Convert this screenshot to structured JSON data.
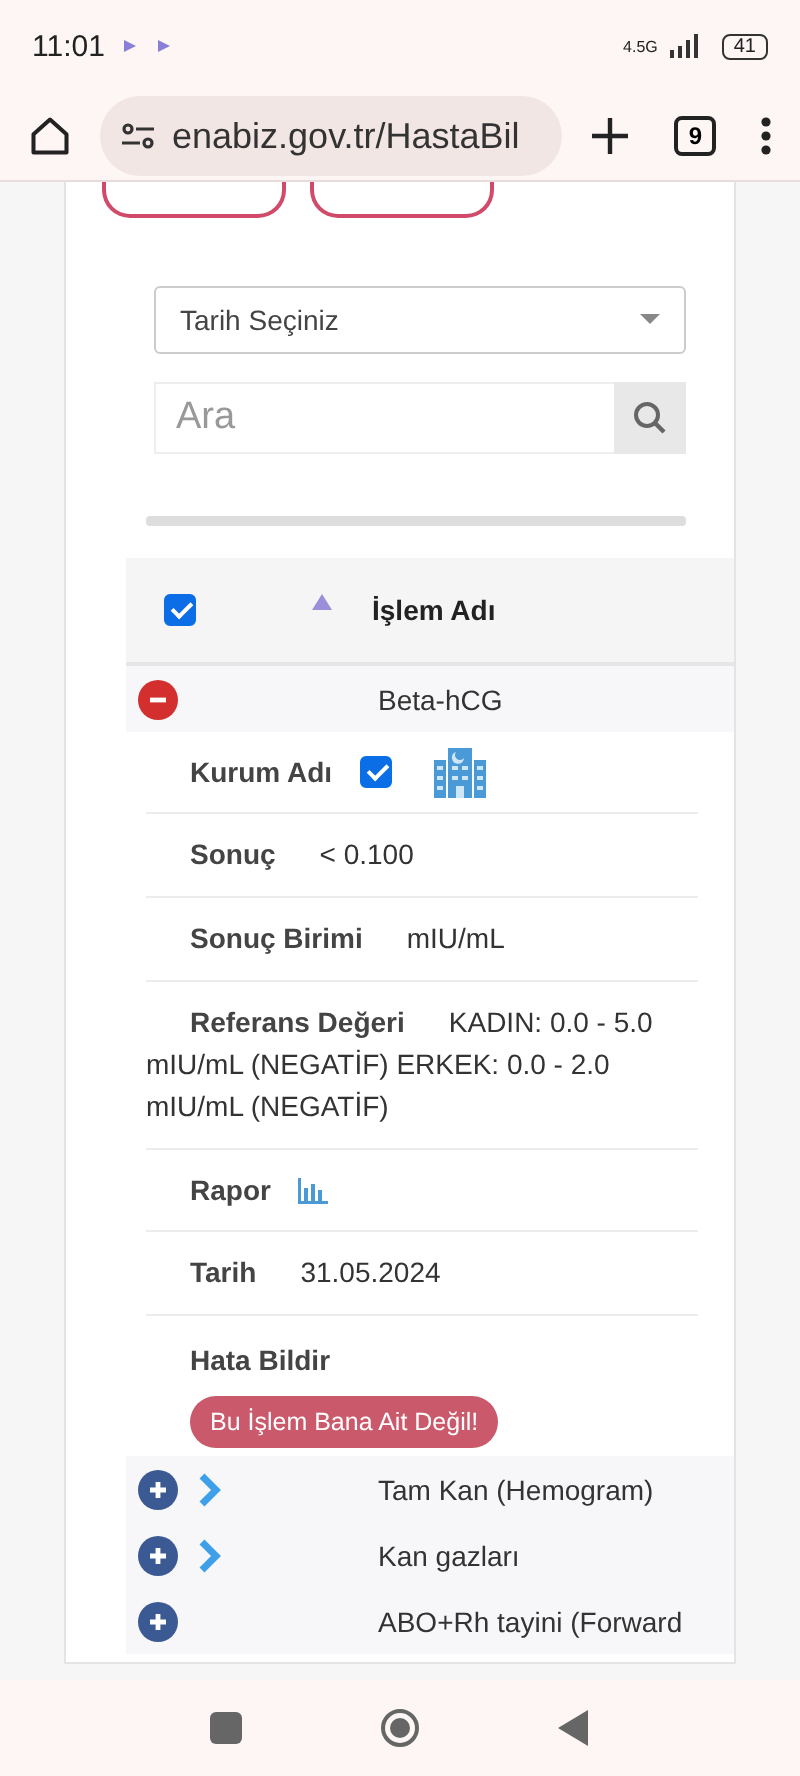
{
  "status_bar": {
    "time": "11:01",
    "network": "4.5G",
    "battery": "41"
  },
  "browser": {
    "url": "enabiz.gov.tr/HastaBil",
    "tab_count": "9"
  },
  "filters": {
    "date_select": "Tarih Seçiniz",
    "search": {
      "placeholder": "Ara"
    }
  },
  "table": {
    "header": {
      "checked": true,
      "column": "İşlem Adı"
    },
    "rows": [
      {
        "name": "Beta-hCG",
        "expanded": true,
        "has_chevron": false,
        "details": [
          {
            "kind": "checkbox",
            "label": "Kurum Adı",
            "checked": true
          },
          {
            "kind": "text",
            "label": "Sonuç",
            "value": "< 0.100"
          },
          {
            "kind": "text",
            "label": "Sonuç Birimi",
            "value": "mIU/mL"
          },
          {
            "kind": "text",
            "label": "Referans Değeri",
            "value": "KADIN: 0.0 - 5.0 mIU/mL (NEGATİF) ERKEK: 0.0 - 2.0 mIU/mL (NEGATİF)"
          },
          {
            "kind": "chart",
            "label": "Rapor"
          },
          {
            "kind": "text",
            "label": "Tarih",
            "value": "31.05.2024"
          },
          {
            "kind": "button",
            "label": "Hata Bildir",
            "value": "Bu İşlem Bana Ait Değil!"
          }
        ]
      },
      {
        "name": "Tam Kan (Hemogram)",
        "expanded": false,
        "has_chevron": true
      },
      {
        "name": "Kan gazları",
        "expanded": false,
        "has_chevron": true
      },
      {
        "name": "ABO+Rh tayini (Forward",
        "expanded": false,
        "has_chevron": false
      }
    ]
  }
}
